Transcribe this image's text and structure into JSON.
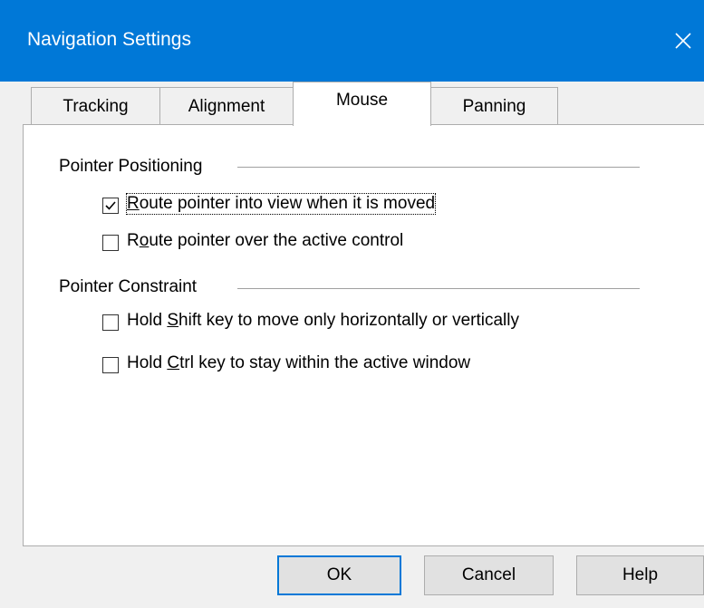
{
  "window": {
    "title": "Navigation Settings",
    "accent_color": "#0078d7",
    "close_icon": "close-icon"
  },
  "tabs": [
    {
      "label": "Tracking",
      "active": false
    },
    {
      "label": "Alignment",
      "active": false
    },
    {
      "label": "Mouse",
      "active": true
    },
    {
      "label": "Panning",
      "active": false
    }
  ],
  "pointer_positioning": {
    "label": "Pointer Positioning",
    "options": [
      {
        "pre": "",
        "key": "R",
        "post": "oute pointer into view when it is moved",
        "checked": true
      },
      {
        "pre": "R",
        "key": "o",
        "post": "ute pointer over the active control",
        "checked": false
      }
    ]
  },
  "pointer_constraint": {
    "label": "Pointer Constraint",
    "options": [
      {
        "pre": "Hold ",
        "key": "S",
        "post": "hift key to move only horizontally or vertically",
        "checked": false
      },
      {
        "pre": "Hold ",
        "key": "C",
        "post": "trl key to stay within the active window",
        "checked": false
      }
    ]
  },
  "buttons": {
    "ok": "OK",
    "cancel": "Cancel",
    "help": "Help"
  }
}
